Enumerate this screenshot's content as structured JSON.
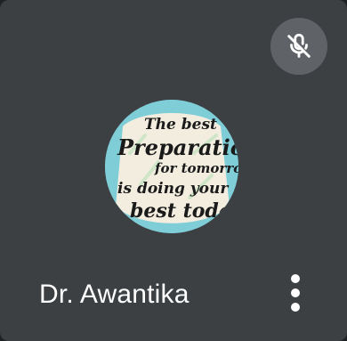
{
  "participant": {
    "name": "Dr. Awantika",
    "muted": true,
    "avatar_quote": {
      "line1": "The best",
      "line2": "Preparation",
      "line3": "for tomorrow",
      "line4": "is doing your",
      "line5": "best today"
    }
  },
  "icons": {
    "mute": "mic-off-icon",
    "more": "more-vert-icon"
  },
  "colors": {
    "tile_background": "#3c4043",
    "mute_badge": "#5f6368",
    "avatar_background": "#7ecdd7",
    "name_text": "#ffffff"
  }
}
